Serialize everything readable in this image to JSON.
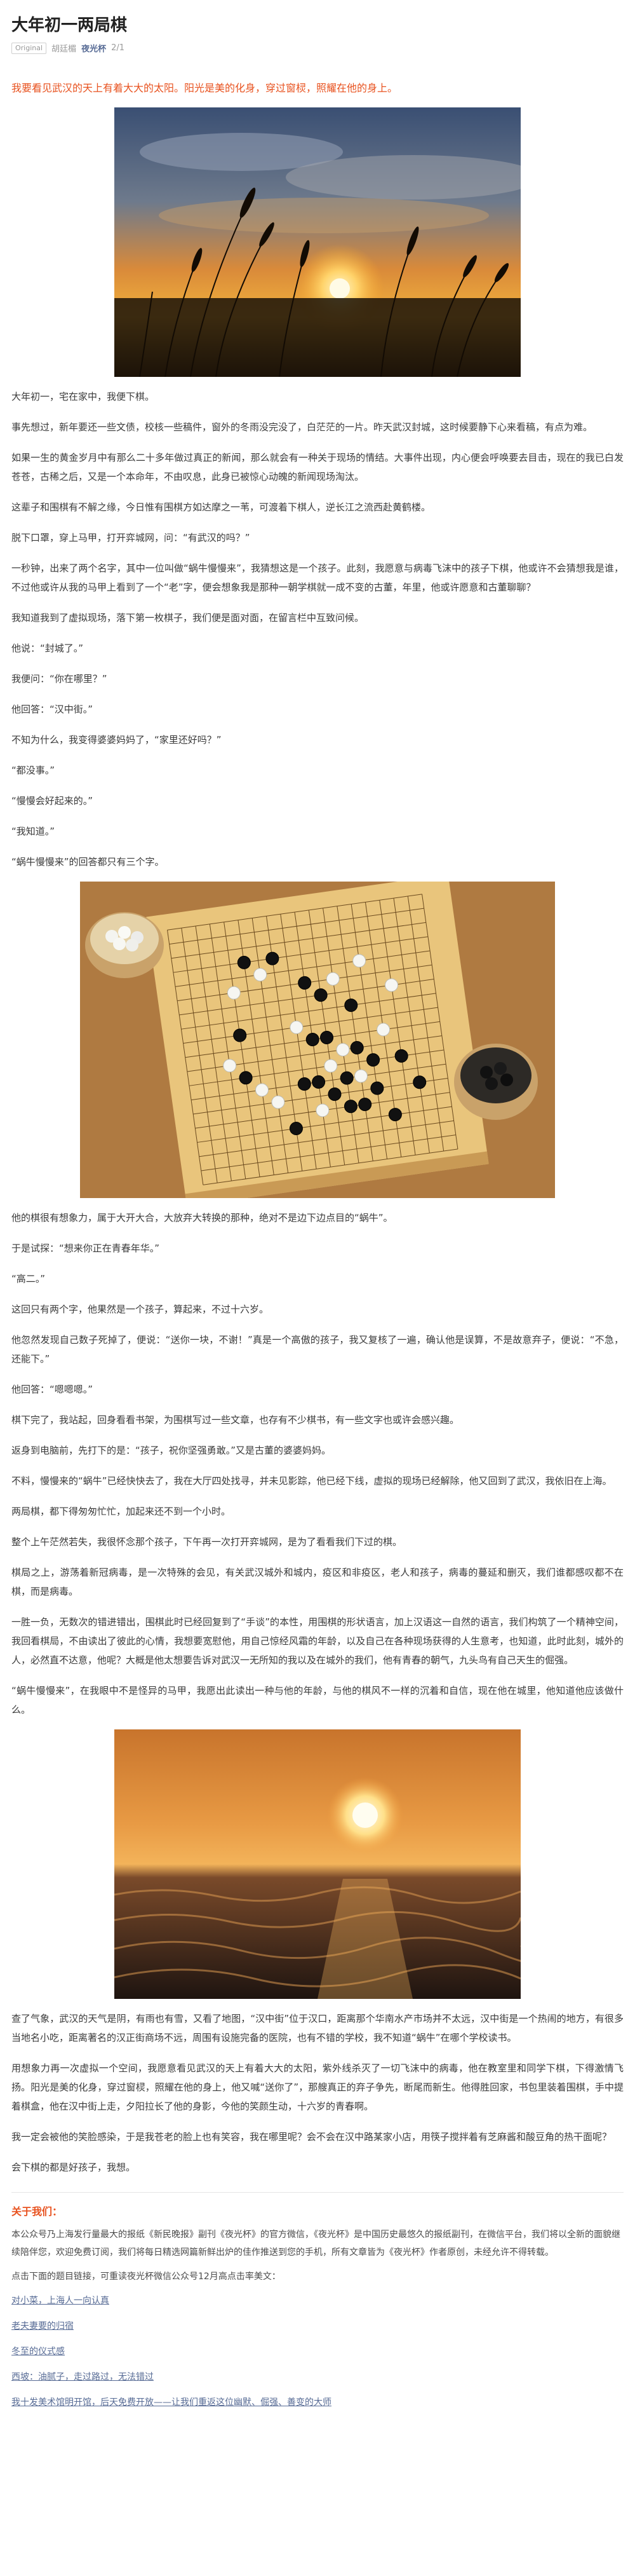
{
  "article": {
    "title": "大年初一两局棋",
    "tag": "Original",
    "author": "胡廷楣",
    "account": "夜光杯",
    "date": "2/1"
  },
  "lead": "我要看见武汉的天上有着大大的太阳。阳光是美的化身，穿过窗棂，照耀在他的身上。",
  "paragraphs": [
    "大年初一，宅在家中，我便下棋。",
    "事先想过，新年要还一些文债，校核一些稿件，窗外的冬雨没完没了，白茫茫的一片。昨天武汉封城，这时候要静下心来看稿，有点为难。",
    "如果一生的黄金岁月中有那么二十多年做过真正的新闻，那么就会有一种关于现场的情结。大事件出现，内心便会呼唤要去目击，现在的我已白发苍苍，古稀之后，又是一个本命年，不由叹息，此身已被惊心动魄的新闻现场淘汰。",
    "这辈子和围棋有不解之缘，今日惟有围棋方如达摩之一苇，可渡着下棋人，逆长江之流西赴黄鹤楼。",
    "脱下口罩，穿上马甲，打开弈城网，问：“有武汉的吗？”",
    "一秒钟，出来了两个名字，其中一位叫做“蜗牛慢慢来”，我猜想这是一个孩子。此刻，我愿意与病毒飞沫中的孩子下棋，他或许不会猜想我是谁，不过他或许从我的马甲上看到了一个“老”字，便会想象我是那种一朝学棋就一成不变的古董，年里，他或许愿意和古董聊聊？",
    "我知道我到了虚拟现场，落下第一枚棋子，我们便是面对面，在留言栏中互致问候。",
    "他说：“封城了。”",
    "我便问：“你在哪里？”",
    "他回答：“汉中街。”",
    "不知为什么，我变得婆婆妈妈了，“家里还好吗？”",
    "“都没事。”",
    "“慢慢会好起来的。”",
    "“我知道。”",
    "“蜗牛慢慢来”的回答都只有三个字。"
  ],
  "paragraphs2": [
    "他的棋很有想象力，属于大开大合，大放弃大转换的那种，绝对不是边下边点目的“蜗牛”。",
    "于是试探：“想来你正在青春年华。”",
    "“高二。”",
    "这回只有两个字，他果然是一个孩子，算起来，不过十六岁。",
    "他忽然发现自己数子死掉了，便说：“送你一块，不谢！”真是一个高傲的孩子，我又复核了一遍，确认他是误算，不是故意弃子，便说：“不急，还能下。”",
    "他回答：“嗯嗯嗯。”",
    "棋下完了，我站起，回身看看书架，为围棋写过一些文章，也存有不少棋书，有一些文字也或许会感兴趣。",
    "返身到电脑前，先打下的是：“孩子，祝你坚强勇敢。”又是古董的婆婆妈妈。",
    "不料，慢慢来的“蜗牛”已经快快去了，我在大厅四处找寻，并未见影踪，他已经下线，虚拟的现场已经解除，他又回到了武汉，我依旧在上海。",
    "两局棋，都下得匆匆忙忙，加起来还不到一个小时。",
    "整个上午茫然若失，我很怀念那个孩子，下午再一次打开弈城网，是为了看看我们下过的棋。",
    "棋局之上，游荡着新冠病毒，是一次特殊的会见，有关武汉城外和城内，疫区和非疫区，老人和孩子，病毒的蔓延和删灭，我们谁都感叹都不在棋，而是病毒。",
    "一胜一负，无数次的错进错出，围棋此时已经回复到了“手谈”的本性，用围棋的形状语言，加上汉语这一自然的语言，我们构筑了一个精神空间，我回看棋局，不由读出了彼此的心情，我想要宽慰他，用自己惊经风霜的年龄，以及自己在各种现场获得的人生意考，也知道，此时此刻，城外的人，必然直不达意，他呢？大概是他太想要告诉对武汉一无所知的我以及在城外的我们，他有青春的朝气，九头鸟有自己天生的倔强。",
    "“蜗牛慢慢来”，在我眼中不是怪异的马甲，我愿出此读出一种与他的年龄，与他的棋风不一样的沉着和自信，现在他在城里，他知道他应该做什么。"
  ],
  "paragraphs3": [
    "查了气象，武汉的天气是阴，有雨也有雪，又看了地图，“汉中街”位于汉口，距离那个华南水产市场并不太远，汉中街是一个热闹的地方，有很多当地名小吃，距离著名的汉正街商场不远，周围有设施完备的医院，也有不错的学校，我不知道“蜗牛”在哪个学校读书。",
    "用想象力再一次虚拟一个空间，我愿意看见武汉的天上有着大大的太阳，紫外线杀灭了一切飞沫中的病毒，他在教室里和同学下棋，下得激情飞扬。阳光是美的化身，穿过窗棂，照耀在他的身上，他又喊“送你了”，那艘真正的弃子争先，断尾而新生。他得胜回家，书包里装着围棋，手中提着棋盒，他在汉中街上走，夕阳拉长了他的身影，今他的笑颜生动，十六岁的青春啊。",
    "我一定会被他的笑脸感染，于是我苍老的脸上也有笑容，我在哪里呢？会不会在汉中路某家小店，用筷子搅拌着有芝麻酱和酸豆角的热干面呢？",
    "会下棋的都是好孩子，我想。"
  ],
  "about": {
    "heading": "关于我们：",
    "intro": "本公众号乃上海发行量最大的报纸《新民晚报》副刊《夜光杯》的官方微信，《夜光杯》是中国历史最悠久的报纸副刊，在微信平台，我们将以全新的面貌继续陪伴您，欢迎免费订阅，我们将每日精选网篇新鲜出炉的佳作推送到您的手机，所有文章皆为《夜光杯》作者原创，未经允许不得转载。",
    "cta": "点击下面的题目链接，可重读夜光杯微信公众号12月高点击率美文：",
    "links": [
      "对小菜，上海人一向认真",
      "老夫妻要的归宿",
      "冬至的仪式感",
      "西坡：油腻子，走过路过，无法错过",
      "我十发美术馆明开馆，后天免费开放——让我们重返这位幽默、倔强、善变的大师"
    ]
  },
  "images": {
    "wheat_alt": "sunset-wheat-photo",
    "go_alt": "go-board-photo",
    "sea_alt": "sunset-sea-photo"
  },
  "colors": {
    "accent": "#e8521f",
    "link": "#576b95"
  }
}
